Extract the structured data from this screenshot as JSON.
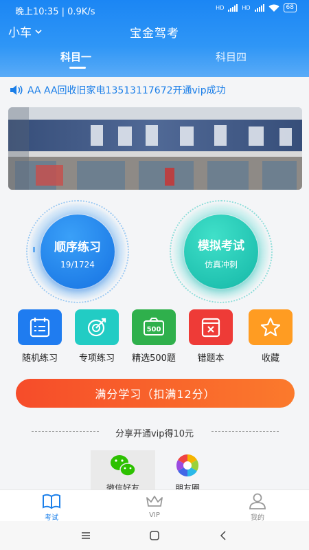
{
  "status": {
    "time_speed": "晚上10:35 | 0.9K/s",
    "sim1": "HD",
    "sim2": "HD",
    "battery": "68"
  },
  "topbar": {
    "car_type": "小车",
    "title": "宝金驾考"
  },
  "tabs": [
    {
      "label": "科目一",
      "active": true
    },
    {
      "label": "科目四",
      "active": false
    }
  ],
  "notice": {
    "text": "AA AA回收旧家电13513117672开通vip成功"
  },
  "practice": {
    "sequential_label": "顺序练习",
    "sequential_progress": "19/1724",
    "mock_label": "模拟考试",
    "mock_sub": "仿真冲刺"
  },
  "features": [
    {
      "label": "随机练习",
      "icon": "calendar-list-icon",
      "color": "#1f7cf0"
    },
    {
      "label": "专项练习",
      "icon": "target-icon",
      "color": "#22ccc4"
    },
    {
      "label": "精选500题",
      "icon": "500-icon",
      "color": "#2fb04c"
    },
    {
      "label": "错题本",
      "icon": "wrong-book-icon",
      "color": "#ee3b37"
    },
    {
      "label": "收藏",
      "icon": "star-icon",
      "color": "#ff9c22"
    }
  ],
  "cta": {
    "label": "满分学习（扣满12分）"
  },
  "share": {
    "title": "分享开通vip得10元",
    "wechat": "微信好友",
    "moments": "朋友圈"
  },
  "tabbar": [
    {
      "label": "考试",
      "icon": "book-icon",
      "active": true
    },
    {
      "label": "VIP",
      "icon": "crown-icon",
      "active": false
    },
    {
      "label": "我的",
      "icon": "user-icon",
      "active": false
    }
  ],
  "colors": {
    "primary": "#1b86f4",
    "cta_start": "#f64c2a",
    "cta_end": "#fb7a2c"
  }
}
